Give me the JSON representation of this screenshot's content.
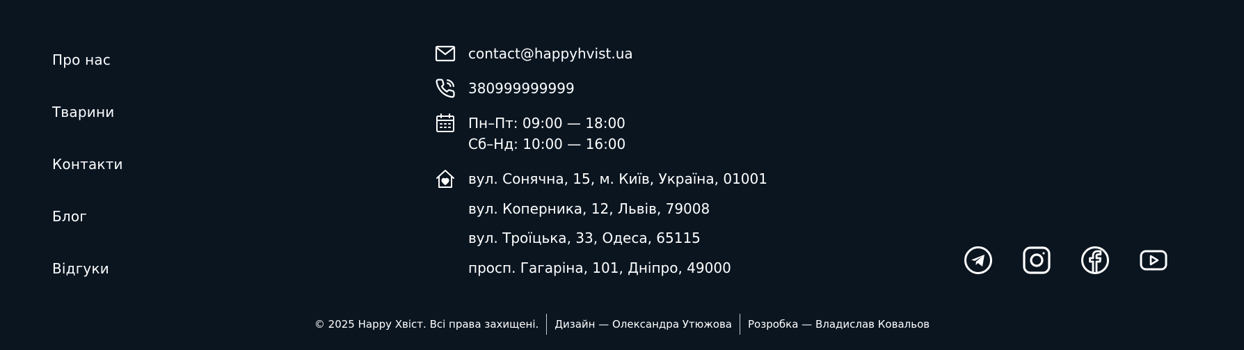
{
  "nav": {
    "items": [
      {
        "label": "Про нас"
      },
      {
        "label": "Тварини"
      },
      {
        "label": "Контакти"
      },
      {
        "label": "Блог"
      },
      {
        "label": "Відгуки"
      }
    ]
  },
  "contacts": {
    "email": {
      "icon": "mail-icon",
      "value": "contact@happyhvist.ua"
    },
    "phone": {
      "icon": "phone-icon",
      "value": "380999999999"
    },
    "hours": {
      "icon": "calendar-icon",
      "weekdays": "Пн–Пт: 09:00 — 18:00",
      "weekend": "Сб–Нд: 10:00 — 16:00"
    },
    "addresses": {
      "icon": "home-heart-icon",
      "items": [
        "вул. Сонячна, 15, м. Київ, Україна, 01001",
        "вул. Коперника, 12, Львів, 79008",
        "вул. Троїцька, 33, Одеса, 65115",
        "просп. Гагаріна, 101, Дніпро, 49000"
      ]
    }
  },
  "socials": [
    {
      "icon": "telegram-icon"
    },
    {
      "icon": "instagram-icon"
    },
    {
      "icon": "facebook-icon"
    },
    {
      "icon": "youtube-icon"
    }
  ],
  "bottom": {
    "copyright": "© 2025 Happy Хвіст. Всі права захищені.",
    "design": "Дизайн — Олександра Утюжова",
    "development": "Розробка — Владислав Ковальов"
  },
  "colors": {
    "background": "#0a1520",
    "text": "#ffffff",
    "separator": "#c9ced4"
  }
}
